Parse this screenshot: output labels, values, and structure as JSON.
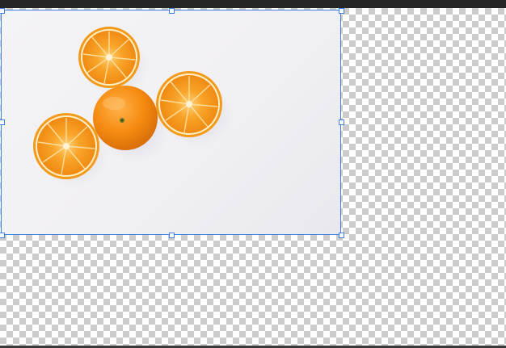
{
  "document": {
    "layer": "oranges-photo",
    "background": "transparent-checkerboard"
  },
  "colors": {
    "selection": "#3f7de0",
    "orange_peel": "#f08a12",
    "orange_flesh": "#f7a323",
    "pith": "#ffe9b8",
    "photo_bg": "#f2f1f5"
  },
  "icons": {
    "transform_handle": "square-handle"
  }
}
